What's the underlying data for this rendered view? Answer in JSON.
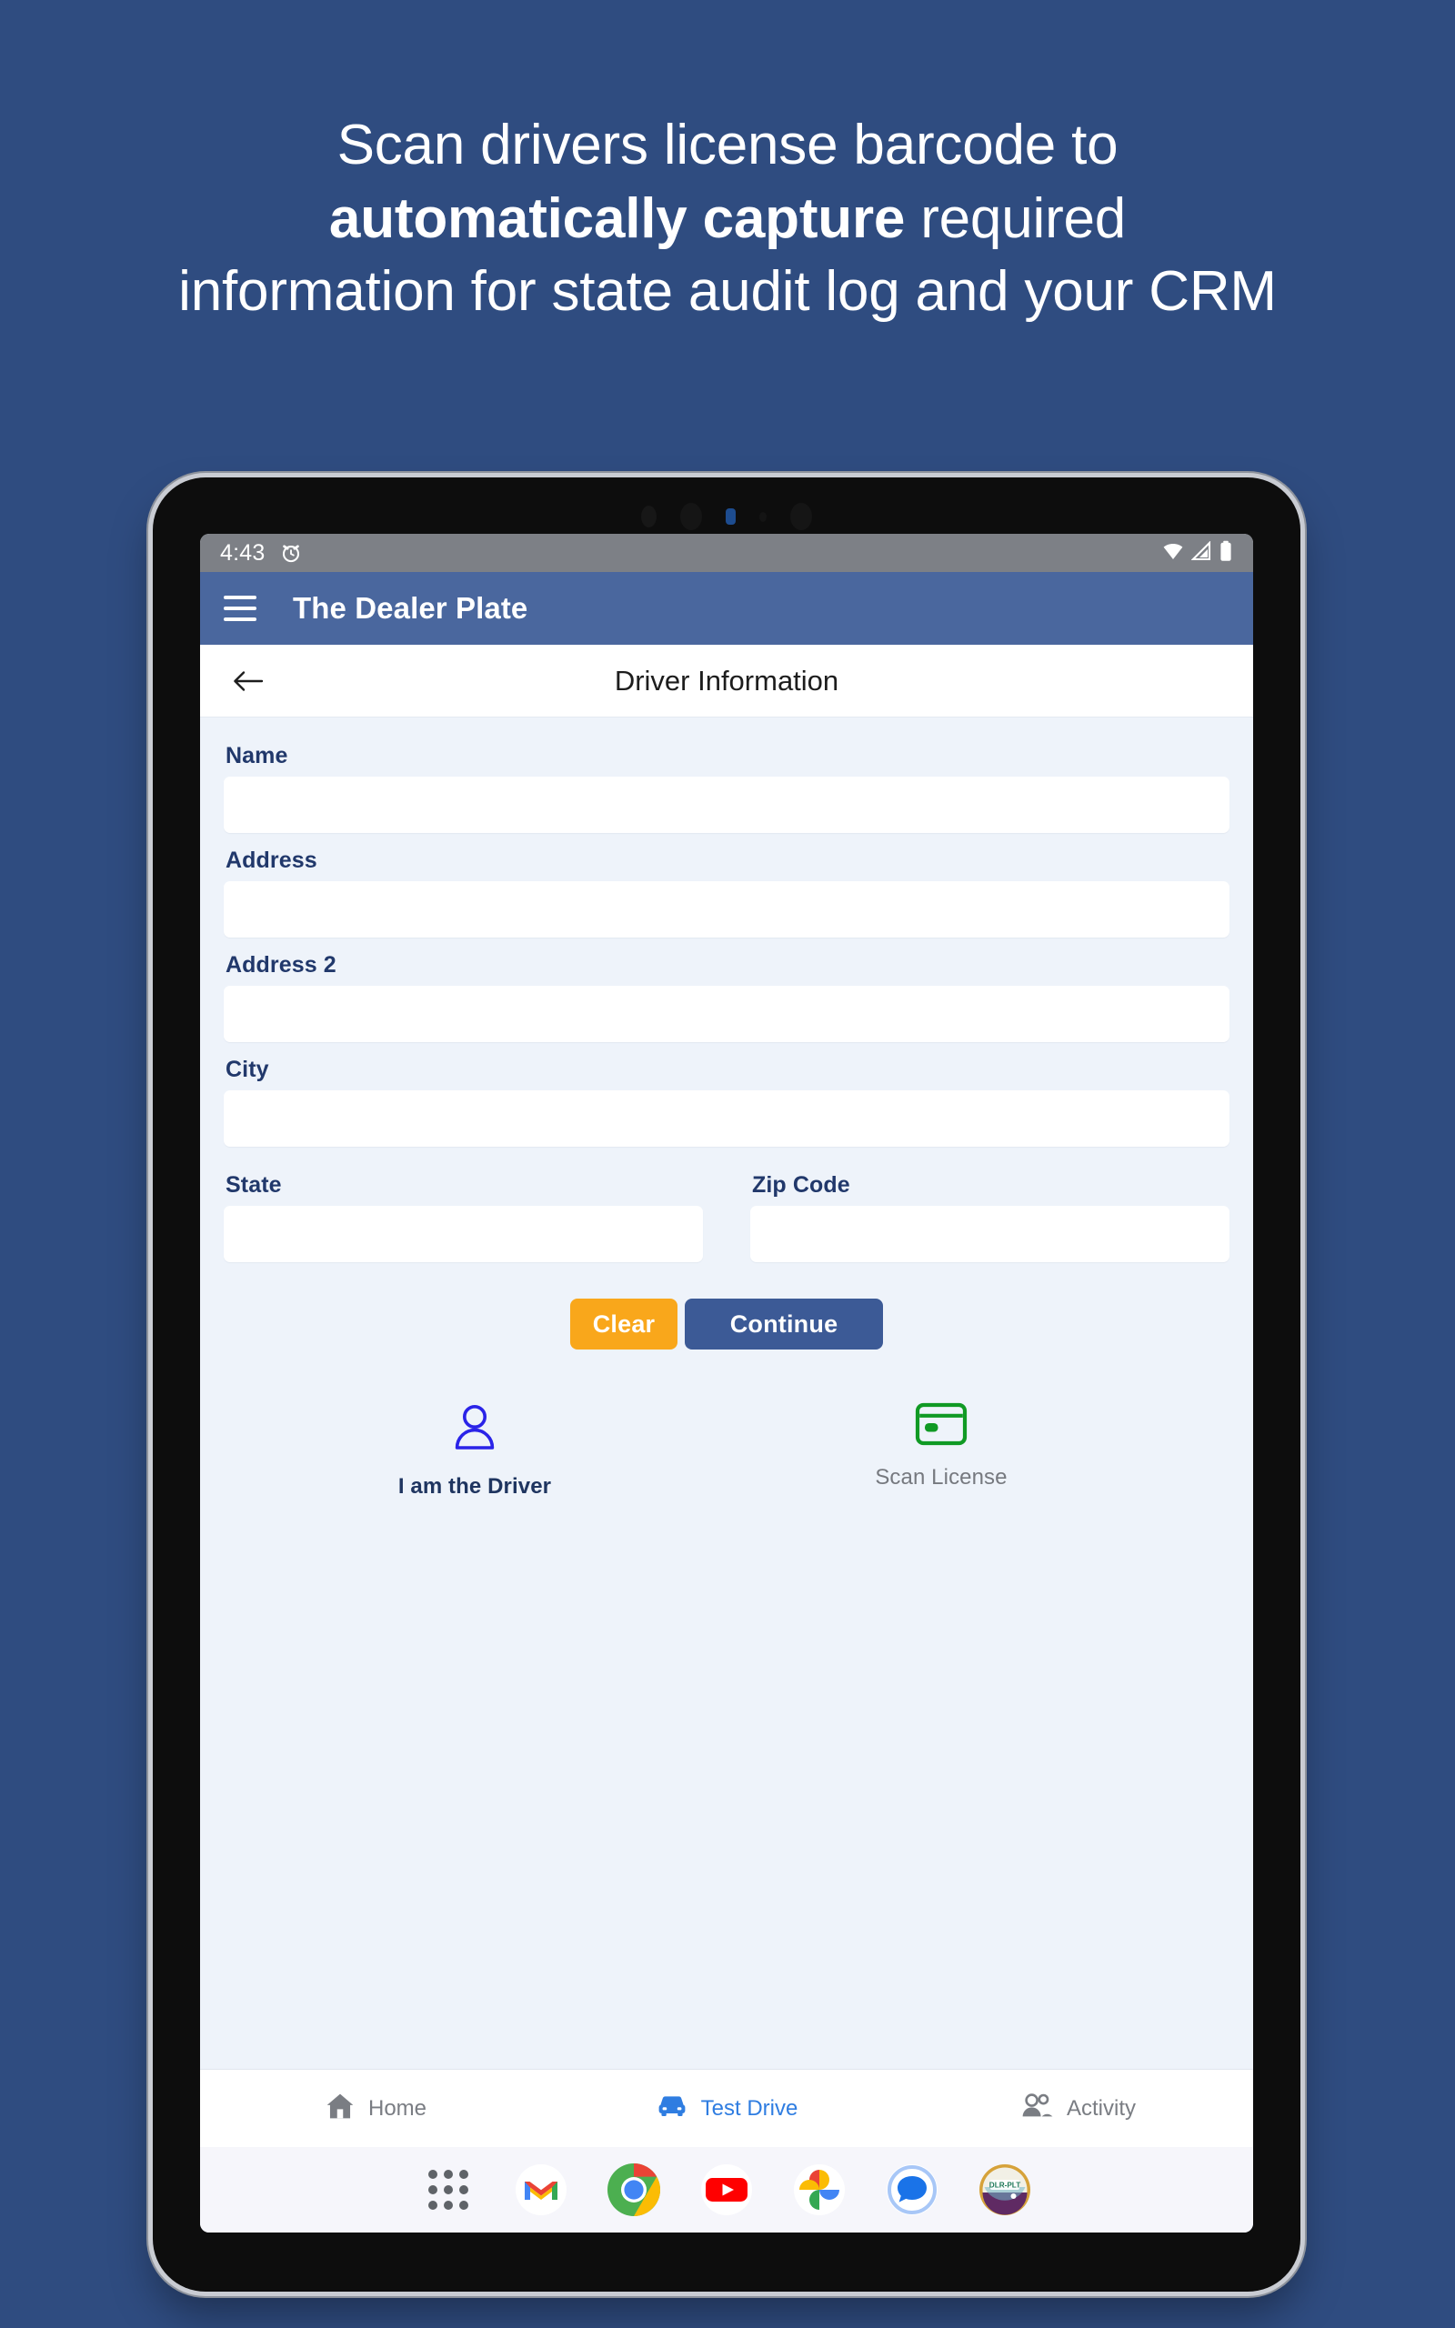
{
  "promo": {
    "line1": "Scan drivers license barcode to",
    "line2_bold": "automatically capture",
    "line2_rest": " required",
    "line3": "information for state audit log and your CRM"
  },
  "status_bar": {
    "time": "4:43",
    "alarm_icon": "alarm-clock-icon",
    "wifi_icon": "wifi-icon",
    "signal_icon": "cell-signal-icon",
    "battery_icon": "battery-icon"
  },
  "app_bar": {
    "menu_icon": "hamburger-menu-icon",
    "title": "The Dealer Plate",
    "background": "#4a679e"
  },
  "sub_header": {
    "back_icon": "back-arrow-icon",
    "title": "Driver Information"
  },
  "form": {
    "fields": [
      {
        "label": "Name",
        "value": "",
        "placeholder": ""
      },
      {
        "label": "Address",
        "value": "",
        "placeholder": ""
      },
      {
        "label": "Address 2",
        "value": "",
        "placeholder": ""
      },
      {
        "label": "City",
        "value": "",
        "placeholder": ""
      }
    ],
    "state": {
      "label": "State",
      "value": "",
      "placeholder": ""
    },
    "zip": {
      "label": "Zip Code",
      "value": "",
      "placeholder": ""
    }
  },
  "buttons": {
    "clear": {
      "label": "Clear",
      "color": "#f9a71b"
    },
    "continue": {
      "label": "Continue",
      "color": "#3c5a96"
    }
  },
  "actions": [
    {
      "label": "I am the Driver",
      "icon": "person-icon",
      "color": "#2a23e8"
    },
    {
      "label": "Scan License",
      "icon": "credit-card-icon",
      "color": "#109a24"
    }
  ],
  "bottom_nav": {
    "items": [
      {
        "label": "Home",
        "icon": "home-icon",
        "active": false
      },
      {
        "label": "Test Drive",
        "icon": "car-icon",
        "active": true
      },
      {
        "label": "Activity",
        "icon": "people-icon",
        "active": false
      }
    ],
    "active_color": "#2f7de1",
    "inactive_color": "#7a7d83"
  },
  "dock": {
    "items": [
      {
        "name": "app-drawer-icon",
        "label": ""
      },
      {
        "name": "gmail-icon",
        "label": ""
      },
      {
        "name": "chrome-icon",
        "label": ""
      },
      {
        "name": "youtube-icon",
        "label": ""
      },
      {
        "name": "google-photos-icon",
        "label": ""
      },
      {
        "name": "google-messages-icon",
        "label": ""
      },
      {
        "name": "dealer-plate-app-icon",
        "label": "DLR-PLT"
      }
    ]
  },
  "theme": {
    "page_background": "#2f4c80",
    "screen_background": "#eef3fa",
    "label_color": "#21386b"
  }
}
